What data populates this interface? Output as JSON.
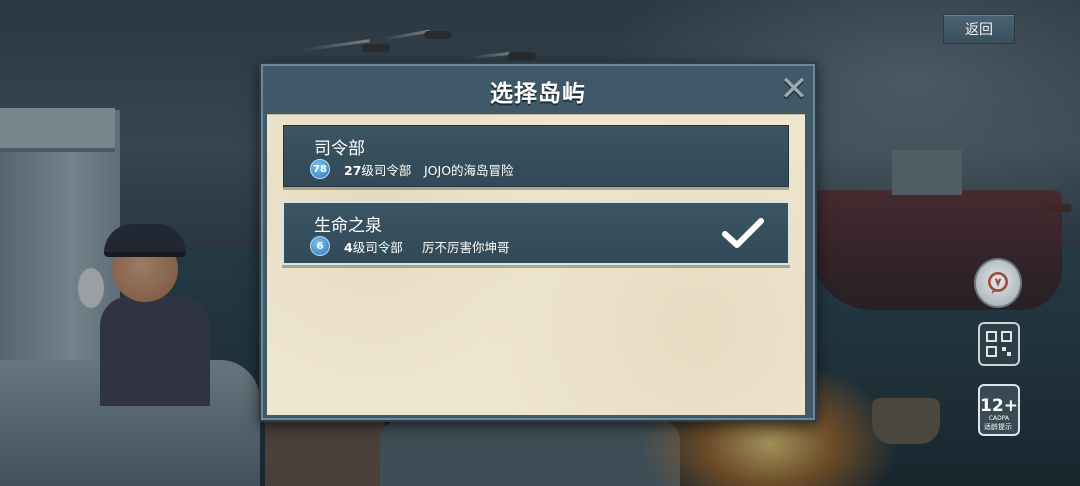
{
  "back_button": {
    "label": "返回"
  },
  "modal": {
    "title": "选择岛屿",
    "close_icon": "close-x-icon",
    "islands": [
      {
        "name": "司令部",
        "level": "78",
        "hq_number": "27",
        "hq_suffix": "级司令部",
        "owner": "JOJO的海岛冒险",
        "selected": false
      },
      {
        "name": "生命之泉",
        "level": "6",
        "hq_number": "4",
        "hq_suffix": "级司令部",
        "owner": "厉不厉害你坤哥",
        "selected": true
      }
    ]
  },
  "side_icons": {
    "chat": "chat-bubble-icon",
    "qr": "qr-code-icon",
    "age_rating": {
      "number": "12+",
      "org": "CADPA",
      "tip": "适龄提示"
    }
  },
  "colors": {
    "panel": "#3f5968",
    "paper": "#efe6d0",
    "row": "#3b5564",
    "check": "#ffffff"
  }
}
